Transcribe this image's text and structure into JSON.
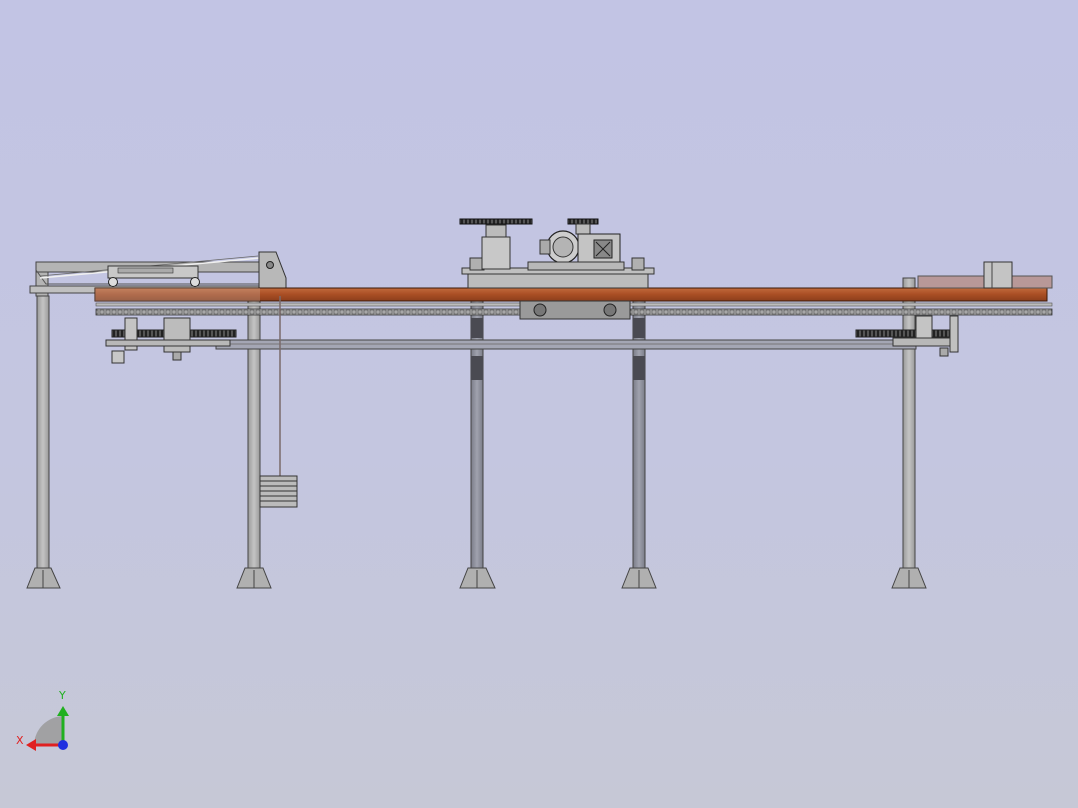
{
  "viewport": {
    "background_top": "#c2c4e4",
    "background_bottom": "#c6c8d6"
  },
  "model": {
    "frame_color": "#a8a8a8",
    "edge_color": "#3a3a3a",
    "board_color": "#b0552a",
    "leg_dark_color": "#8a8c98",
    "motor_color": "#c8c8c8"
  },
  "triad": {
    "x_label": "X",
    "y_label": "Y",
    "x_color": "#e02020",
    "y_color": "#20b020",
    "z_color": "#2030e0"
  }
}
